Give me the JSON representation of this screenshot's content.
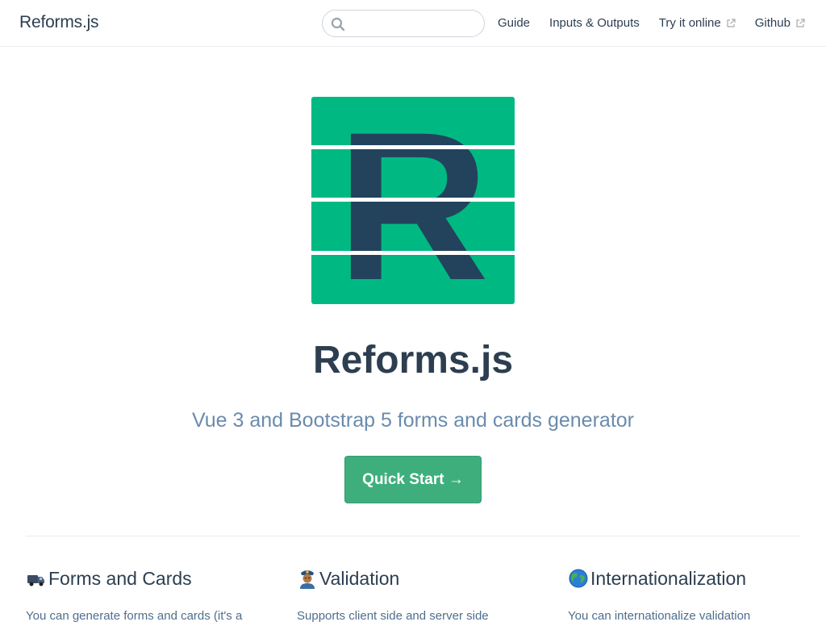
{
  "navbar": {
    "site_name": "Reforms.js",
    "search": {
      "placeholder": "",
      "value": ""
    },
    "links": [
      {
        "label": "Guide",
        "external": false
      },
      {
        "label": "Inputs & Outputs",
        "external": false
      },
      {
        "label": "Try it online",
        "external": true
      },
      {
        "label": "Github",
        "external": true
      }
    ]
  },
  "hero": {
    "logo_letter": "R",
    "title": "Reforms.js",
    "description": "Vue 3 and Bootstrap 5 forms and cards generator",
    "action_label": "Quick Start →"
  },
  "features": [
    {
      "icon": "truck-icon",
      "title": "Forms and Cards",
      "text": "You can generate forms and cards (it's a"
    },
    {
      "icon": "police-officer-icon",
      "title": "Validation",
      "text": "Supports client side and server side"
    },
    {
      "icon": "globe-icon",
      "title": "Internationalization",
      "text": "You can internationalize validation"
    }
  ],
  "colors": {
    "accent": "#3eaf7c",
    "logo_green": "#00b982",
    "logo_navy": "#23435d",
    "text": "#2c3e50",
    "description": "#6a8bad"
  }
}
